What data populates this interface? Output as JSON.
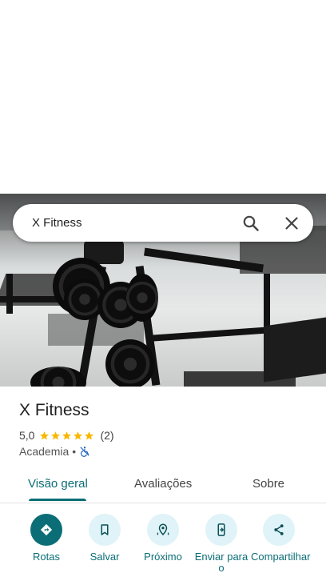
{
  "search": {
    "query": "X Fitness"
  },
  "place": {
    "name": "X Fitness",
    "rating": "5,0",
    "review_count": "(2)",
    "category": "Academia",
    "separator": "•",
    "stars": 5
  },
  "tabs": [
    {
      "label": "Visão geral",
      "active": true
    },
    {
      "label": "Avaliações",
      "active": false
    },
    {
      "label": "Sobre",
      "active": false
    }
  ],
  "actions": [
    {
      "label": "Rotas",
      "icon": "directions-icon"
    },
    {
      "label": "Salvar",
      "icon": "bookmark-icon"
    },
    {
      "label": "Próximo",
      "icon": "nearby-icon"
    },
    {
      "label": "Enviar para o",
      "icon": "send-to-phone-icon"
    },
    {
      "label": "Compartilhar",
      "icon": "share-icon"
    }
  ],
  "colors": {
    "accent": "#0b6e76",
    "star": "#f9b700",
    "chip_bg": "#dff3f8",
    "accessibility": "#1a5fbf"
  }
}
